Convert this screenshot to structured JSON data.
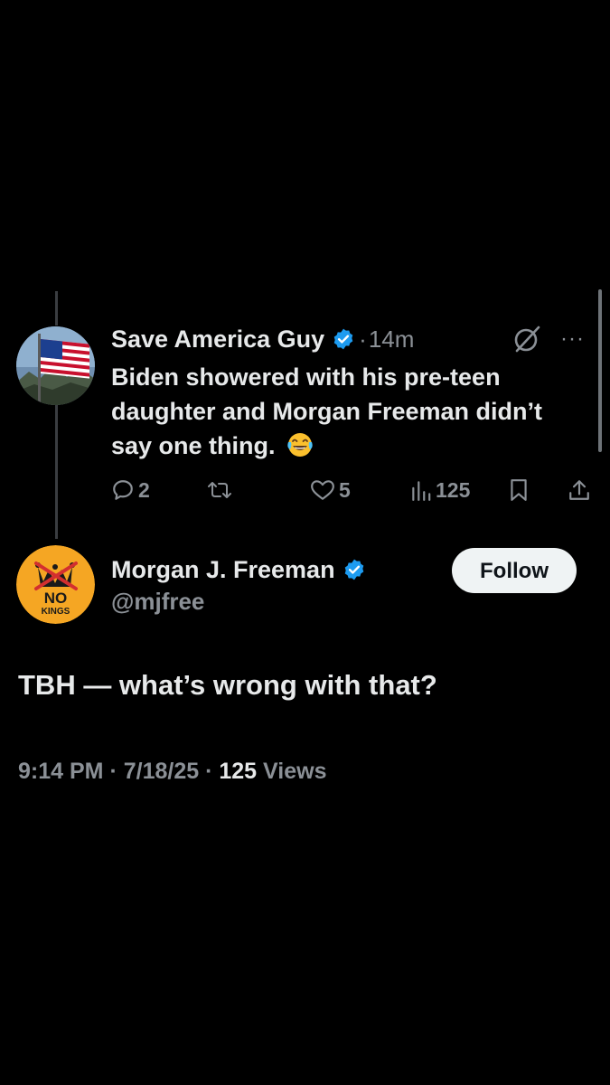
{
  "parent_tweet": {
    "author_name": "Save America Guy",
    "verified": true,
    "separator": "·",
    "time_ago": "14m",
    "text": "Biden showered with his pre-teen daughter and Morgan Freeman didn’t say one thing.",
    "emoji": "face-with-tears-of-joy",
    "more_label": "···",
    "actions": {
      "replies": "2",
      "reposts": "",
      "likes": "5",
      "views": "125"
    }
  },
  "reply_tweet": {
    "author_name": "Morgan J. Freeman",
    "verified": true,
    "handle": "@mjfree",
    "follow_label": "Follow",
    "avatar_text_top": "NO",
    "avatar_text_bottom": "KINGS",
    "text": "TBH — what’s wrong with that?",
    "time": "9:14 PM",
    "separator": "·",
    "date": "7/18/25",
    "views_count": "125",
    "views_label": "Views"
  },
  "colors": {
    "background": "#000000",
    "primary_text": "#e7e9ea",
    "secondary_text": "#8b9096",
    "verified_blue": "#1d9bf0",
    "follow_bg": "#eff3f4",
    "avatar_yellow": "#f5a623"
  },
  "icons": [
    "reply-icon",
    "repost-icon",
    "like-icon",
    "views-icon",
    "bookmark-icon",
    "share-icon",
    "grok-icon",
    "more-icon",
    "verified-badge-icon"
  ]
}
